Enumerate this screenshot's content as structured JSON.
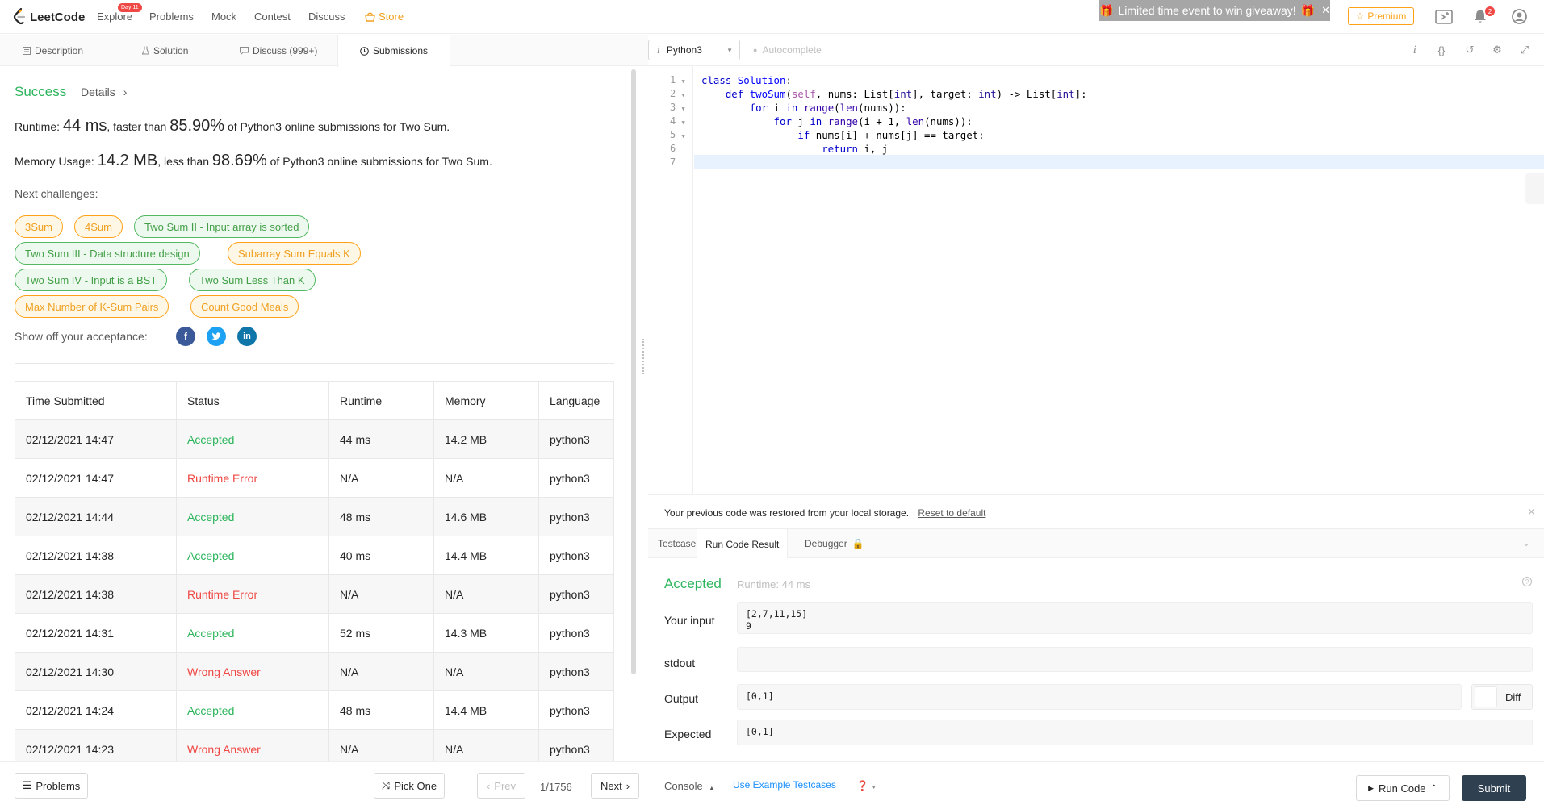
{
  "nav": {
    "logo_text": "LeetCode",
    "items": [
      "Explore",
      "Problems",
      "Mock",
      "Contest",
      "Discuss",
      "Store"
    ],
    "explore_badge": "Day 11",
    "giveaway_text": "Limited time event to win giveaway!",
    "premium_label": "Premium",
    "notification_count": "2"
  },
  "tabs": [
    "Description",
    "Solution",
    "Discuss (999+)",
    "Submissions"
  ],
  "submission": {
    "status": "Success",
    "details_label": "Details",
    "runtime_prefix": "Runtime: ",
    "runtime_value": "44 ms",
    "runtime_mid": ", faster than ",
    "runtime_pct": "85.90%",
    "runtime_suffix": " of Python3 online submissions for Two Sum.",
    "memory_prefix": "Memory Usage: ",
    "memory_value": "14.2 MB",
    "memory_mid": ", less than ",
    "memory_pct": "98.69%",
    "memory_suffix": " of Python3 online submissions for Two Sum.",
    "next_label": "Next challenges:",
    "challenges": [
      {
        "label": "3Sum",
        "difficulty": "medium"
      },
      {
        "label": "4Sum",
        "difficulty": "medium"
      },
      {
        "label": "Two Sum II - Input array is sorted",
        "difficulty": "easy"
      },
      {
        "label": "Two Sum III - Data structure design",
        "difficulty": "easy"
      },
      {
        "label": "Subarray Sum Equals K",
        "difficulty": "medium"
      },
      {
        "label": "Two Sum IV - Input is a BST",
        "difficulty": "easy"
      },
      {
        "label": "Two Sum Less Than K",
        "difficulty": "easy"
      },
      {
        "label": "Max Number of K-Sum Pairs",
        "difficulty": "medium"
      },
      {
        "label": "Count Good Meals",
        "difficulty": "medium"
      }
    ],
    "share_label": "Show off your acceptance:"
  },
  "table": {
    "headers": [
      "Time Submitted",
      "Status",
      "Runtime",
      "Memory",
      "Language"
    ],
    "rows": [
      [
        "02/12/2021 14:47",
        "Accepted",
        "44 ms",
        "14.2 MB",
        "python3"
      ],
      [
        "02/12/2021 14:47",
        "Runtime Error",
        "N/A",
        "N/A",
        "python3"
      ],
      [
        "02/12/2021 14:44",
        "Accepted",
        "48 ms",
        "14.6 MB",
        "python3"
      ],
      [
        "02/12/2021 14:38",
        "Accepted",
        "40 ms",
        "14.4 MB",
        "python3"
      ],
      [
        "02/12/2021 14:38",
        "Runtime Error",
        "N/A",
        "N/A",
        "python3"
      ],
      [
        "02/12/2021 14:31",
        "Accepted",
        "52 ms",
        "14.3 MB",
        "python3"
      ],
      [
        "02/12/2021 14:30",
        "Wrong Answer",
        "N/A",
        "N/A",
        "python3"
      ],
      [
        "02/12/2021 14:24",
        "Accepted",
        "48 ms",
        "14.4 MB",
        "python3"
      ],
      [
        "02/12/2021 14:23",
        "Wrong Answer",
        "N/A",
        "N/A",
        "python3"
      ]
    ]
  },
  "bottom_left": {
    "problems_label": "Problems",
    "pick_one_label": "Pick One",
    "prev_label": "Prev",
    "page": "1/1756",
    "next_label": "Next"
  },
  "editor": {
    "language": "Python3",
    "autocomplete_label": "Autocomplete",
    "line_numbers": [
      "1",
      "2",
      "3",
      "4",
      "5",
      "6",
      "7"
    ],
    "code_lines": [
      "class Solution:",
      "    def twoSum(self, nums: List[int], target: int) -> List[int]:",
      "        for i in range(len(nums)):",
      "            for j in range(i + 1, len(nums)):",
      "                if nums[i] + nums[j] == target:",
      "                    return i, j",
      ""
    ]
  },
  "console": {
    "restored_text": "Your previous code was restored from your local storage.",
    "reset_label": "Reset to default",
    "tabs": [
      "Testcase",
      "Run Code Result",
      "Debugger"
    ],
    "result_status": "Accepted",
    "result_runtime": "Runtime: 44 ms",
    "input_label": "Your input",
    "input_value": "[2,7,11,15]\n9",
    "stdout_label": "stdout",
    "stdout_value": "",
    "output_label": "Output",
    "output_value": "[0,1]",
    "diff_label": "Diff",
    "expected_label": "Expected",
    "expected_value": "[0,1]",
    "console_label": "Console",
    "example_label": "Use Example Testcases",
    "run_label": "Run Code",
    "submit_label": "Submit"
  },
  "colors": {
    "accent_orange": "#ffa116",
    "success_green": "#2db55d",
    "error_red": "#ef4743",
    "submit_bg": "#2f4050"
  }
}
